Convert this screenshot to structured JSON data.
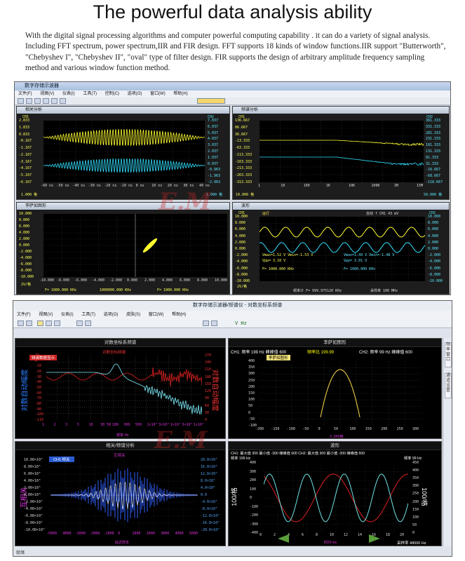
{
  "headline": "The powerful data analysis ability",
  "description": "With the digital signal processing algorithms and computer powerful computing capability . it can do a variety of signal analysis. Including FFT spectrum, power spectrum,IIR and FIR design. FFT supports 18 kinds of window functions.IIR support \"Butterworth\", \"Chebyshev I\", \"Chebyshev II\", \"oval\" type of filter design. FIR supports the design of arbitrary amplitude frequency sampling method and various window function method.",
  "watermark": "ElecM",
  "top_window": {
    "title": "数字存储示波器",
    "menu": [
      "文件(F)",
      "视图(V)",
      "仪表(I)",
      "工具(T)",
      "控制(C)",
      "选项(O)",
      "窗口(W)",
      "帮助(H)"
    ],
    "panes": {
      "modulation": {
        "title": "相关分析",
        "ch1": "CH1",
        "ch2": "CH2",
        "left_ticks": [
          "2.833",
          "1.833",
          "0.833",
          "-0.167",
          "-1.167",
          "-2.167",
          "-3.167",
          "-4.167",
          "-5.167",
          "-6.167"
        ],
        "right_ticks": [
          "7.037",
          "6.037",
          "5.037",
          "4.037",
          "3.037",
          "2.037",
          "1.037",
          "0.037",
          "-0.963",
          "-1.963",
          "-2.963"
        ],
        "x_ticks": [
          "-60 ns",
          "-50 ns",
          "-40 ns",
          "-30 ns",
          "-20 ns",
          "-10 ns",
          "0 ns",
          "10 ns",
          "20 ns",
          "30 ns",
          "40 ns"
        ],
        "scale_left": "1.000 格",
        "scale_right": "1.000 格"
      },
      "bode": {
        "title": "频谱分析",
        "ch1": "CH1",
        "ch2": "CH2",
        "left_ticks": [
          "136.667",
          "86.667",
          "36.667",
          "-13.333",
          "-63.333",
          "-113.333",
          "-163.333",
          "-213.333",
          "-263.333",
          "-313.333"
        ],
        "right_ticks": [
          "381.333",
          "331.333",
          "281.333",
          "231.333",
          "181.333",
          "131.333",
          "81.333",
          "31.333",
          "-18.667",
          "-68.667",
          "-118.667"
        ],
        "x_ticks": [
          "1",
          "10",
          "100",
          "1K",
          "10K",
          "100K",
          "1M",
          "15M"
        ],
        "scale_left": "10.000 格",
        "scale_right": "50.000 格"
      },
      "lissajous": {
        "title": "李萨如图形",
        "y_ticks": [
          "10.000",
          "8.000",
          "6.000",
          "4.000",
          "2.000",
          "0.000",
          "-2.000",
          "-4.000",
          "-6.000",
          "-8.000",
          "-10.000"
        ],
        "x_ticks": [
          "-10.000",
          "-8.000",
          "-6.000",
          "-4.000",
          "-2.000",
          "0.000",
          "2.000",
          "4.000",
          "6.000",
          "8.000",
          "10.000"
        ],
        "freq_left": "F= 1000.000 KHz",
        "freq_mid": "1000000.000 KHz",
        "freq_right": "F= 1000.000 KHz",
        "scale": "2V/格"
      },
      "waveform": {
        "title": "波形",
        "ch1": "CH1",
        "ch2": "CH2",
        "status": "运行",
        "trigger": "自动  f  CH1  43 mV",
        "y_ticks": [
          "10.000",
          "8.000",
          "6.000",
          "4.000",
          "2.000",
          "0.000",
          "-2.000",
          "-4.000",
          "-6.000",
          "-8.000",
          "-10.000"
        ],
        "meas_ch1_a": "Vmax=1.52 V  Vmin=-1.53 V",
        "meas_ch1_b": "Vpp= 3.10 V",
        "meas_ch2_a": "Vmax=1.49 V  Vmin=-1.48 V",
        "meas_ch2_b": "Vpp= 3.01 V",
        "freq_ch1": "F= 1000.000 KHz",
        "freq_ch2": "F= 1000.000 KHz",
        "footer_a": "频率计  F= 999.975120 KHz",
        "footer_b": "采样率 100 MHz",
        "scale": "2V/格"
      }
    }
  },
  "bottom_window": {
    "title": "数字存储示波器/频谱仪  -  对数坐标系频谱",
    "menu": [
      "文件(F)",
      "视图(V)",
      "仪表(I)",
      "工具(T)",
      "选项(O)",
      "皮肤(S)",
      "窗口(W)",
      "帮助(H)"
    ],
    "toolbar_hz": "V  Hz",
    "status": "就绪",
    "side_tabs": [
      "频率窗口",
      "通道设置"
    ],
    "panes": {
      "log_spectrum": {
        "title": "对数坐标系频谱",
        "inner_title": "对数坐标频谱",
        "ylabel_left": "对数自动幅度",
        "ylabel_right": "对数自动幅度",
        "legend": "频谱数据显示",
        "x_ticks": [
          "1",
          "2",
          "3",
          "5",
          "10",
          "30 50",
          "100",
          "300",
          "500",
          "1×10³",
          "3×10³",
          "1×10⁴",
          "3×10⁴",
          "1×10⁵"
        ],
        "left_ticks": [
          "10",
          "0",
          "-10",
          "-20",
          "-30",
          "-40",
          "-50",
          "-60",
          "-70",
          "-80",
          "-90",
          "-100",
          "-110"
        ],
        "right_ticks": [
          "270",
          "240",
          "210",
          "180",
          "150",
          "120",
          "90",
          "60",
          "30",
          "0"
        ],
        "xlabel": "频率 Hz"
      },
      "lissajous": {
        "title": "李萨如图形",
        "header": "CH1: 频率 199 Hz  峰峰值 600",
        "header_mid": "频率比 199.99",
        "header_right": "CH2: 频率 99 Hz  峰峰值 600",
        "button": "李萨如图形",
        "y_ticks": [
          "400",
          "350",
          "300",
          "250",
          "200",
          "150",
          "100",
          "50",
          "0",
          "-50",
          "-100"
        ],
        "x_ticks": [
          "-200",
          "-150",
          "-100",
          "-50",
          "0",
          "50",
          "100",
          "150",
          "200",
          "250",
          "300"
        ],
        "xlabel": "X 100/格"
      },
      "correlation": {
        "title": "相关/频谱分析",
        "inner_title": "互相关",
        "ylabel": "互相关",
        "legend": "CH1 相关",
        "left_ticks": [
          "10.00×10⁵",
          "8.00×10⁵",
          "6.00×10⁵",
          "4.00×10⁵",
          "2.00×10⁵",
          "0.00×10⁰",
          "-2.00×10⁵",
          "-4.00×10⁵",
          "-6.00×10⁵",
          "-8.00×10⁵",
          "-10.00×10⁵"
        ],
        "right_ticks": [
          "20.0×10⁵",
          "16.0×10⁵",
          "12.0×10⁵",
          "8.0×10⁵",
          "4.0×10⁵",
          "0.0",
          "-4.0×10⁵",
          "-8.0×10⁵",
          "-12.0×10⁵",
          "-16.0×10⁵",
          "-20.0×10⁵"
        ],
        "x_ticks": [
          "-5000",
          "-4000",
          "-3000",
          "-2000",
          "-1000",
          "0",
          "1000",
          "2000",
          "3000",
          "4000",
          "5000"
        ],
        "xlabel": "延迟样本"
      },
      "waveform": {
        "title": "波形",
        "header": "CH1: 最大值 300  最小值 -300  峰峰值 600    CH2: 最大值 300  最小值 -300  峰峰值 600",
        "freq_left": "频率 199 Hz",
        "freq_right": "频率 99 Hz",
        "ylabel_left": "100/格",
        "ylabel_right": "100/格",
        "left_ticks": [
          "400",
          "300",
          "200",
          "100",
          "0",
          "-100",
          "-200",
          "-300",
          "-400"
        ],
        "right_ticks": [
          "450",
          "400",
          "350",
          "300",
          "250",
          "200",
          "150",
          "100",
          "50",
          "0"
        ],
        "x_ticks": [
          "0",
          "2",
          "4",
          "6",
          "8",
          "10",
          "12",
          "14",
          "16",
          "18",
          "20"
        ],
        "xlabel": "时间 ms",
        "sample_rate": "采样率 48000 Hz"
      }
    }
  },
  "colors": {
    "ch1": "#ffff30",
    "ch2": "#30e0ff",
    "red": "#e02020",
    "accent": "#2a6bd1"
  }
}
